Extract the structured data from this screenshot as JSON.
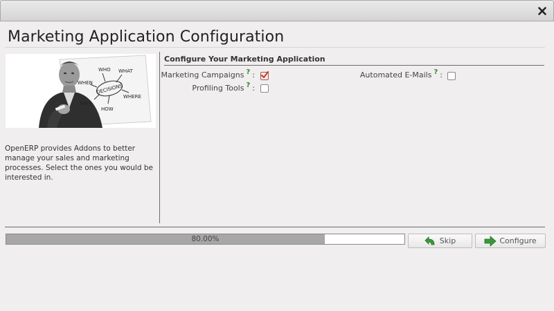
{
  "window": {
    "close_icon": "close-icon"
  },
  "page": {
    "title": "Marketing Application Configuration"
  },
  "left": {
    "illustration_words": [
      "WHO",
      "WHAT",
      "WHEN",
      "WHERE",
      "WHY",
      "HOW",
      "DECISIONS"
    ],
    "description": "OpenERP provides Addons to better manage your sales and marketing processes. Select the ones you would be interested in."
  },
  "form": {
    "section_title": "Configure Your Marketing Application",
    "help_mark": "?",
    "colon": ":",
    "fields": [
      {
        "label": "Marketing Campaigns",
        "checked": true
      },
      {
        "label": "Automated E-Mails",
        "checked": false
      },
      {
        "label": "Profiling Tools",
        "checked": false
      }
    ]
  },
  "progress": {
    "value": 80.0,
    "label": "80.00%"
  },
  "buttons": {
    "skip": {
      "label": "Skip",
      "icon": "skip-arrow-icon"
    },
    "configure": {
      "label": "Configure",
      "icon": "configure-arrow-icon"
    }
  },
  "colors": {
    "help": "#2a8a2a",
    "progress_fill": "#a7a7a7",
    "check_mark": "#c0392b"
  }
}
